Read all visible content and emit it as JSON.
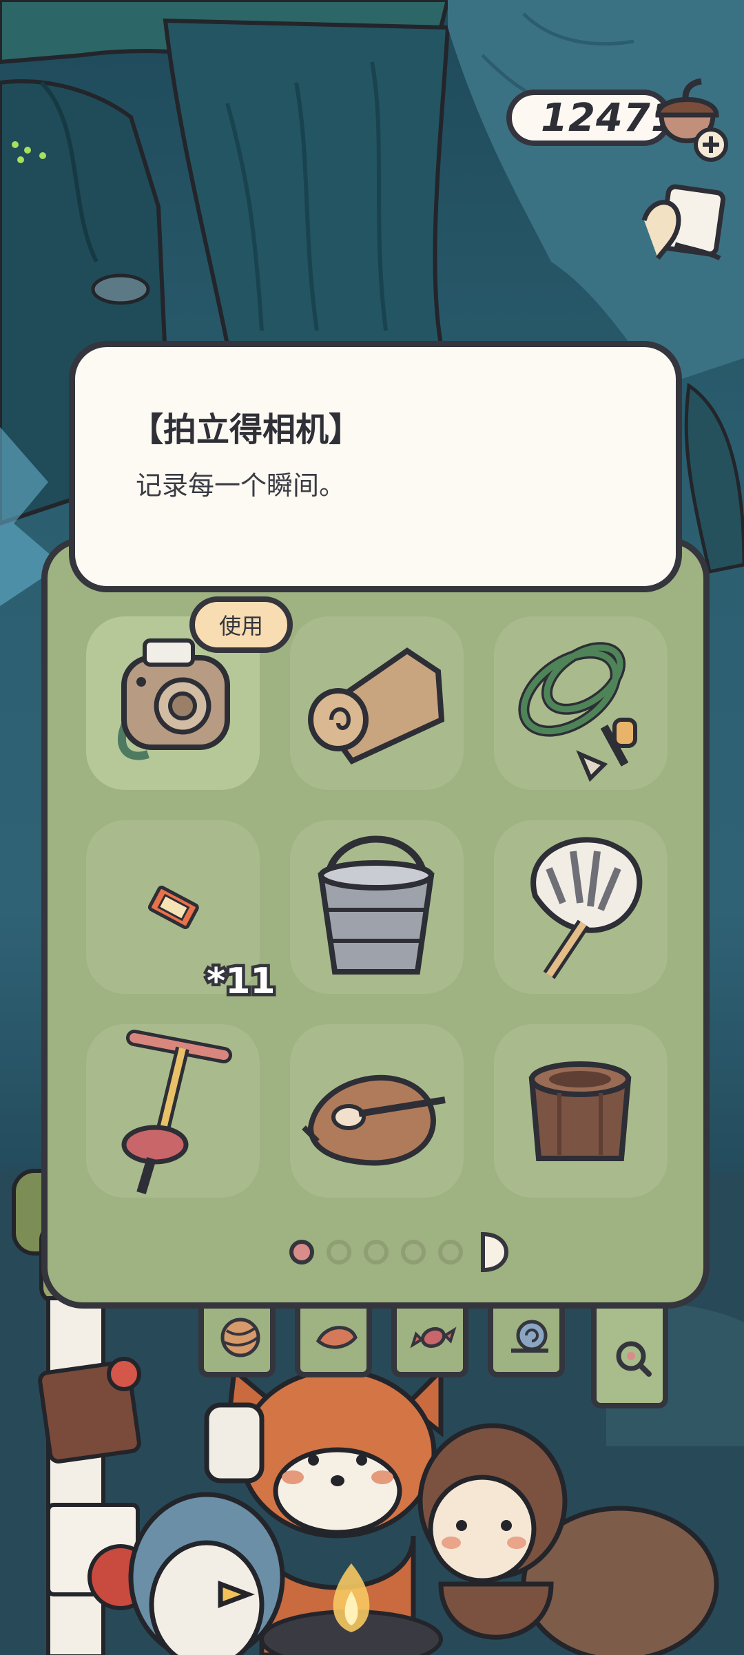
{
  "currency": {
    "value": "12471",
    "icon": "acorn-icon"
  },
  "selected_item": {
    "title": "【拍立得相机】",
    "description": "记录每一个瞬间。"
  },
  "inventory": {
    "use_label": "使用",
    "slots": [
      {
        "icon": "instant-camera-icon",
        "selected": true
      },
      {
        "icon": "rolled-mat-icon"
      },
      {
        "icon": "rope-coil-icon"
      },
      {
        "icon": "ticket-icon",
        "count": "*11"
      },
      {
        "icon": "metal-bucket-icon"
      },
      {
        "icon": "hand-fan-icon"
      },
      {
        "icon": "hand-pump-icon"
      },
      {
        "icon": "roast-chicken-icon"
      },
      {
        "icon": "wooden-bucket-icon"
      }
    ],
    "pages": {
      "total": 5,
      "current": 1
    }
  },
  "tabs": [
    {
      "icon": "yarn-ball-icon"
    },
    {
      "icon": "leaf-icon"
    },
    {
      "icon": "candy-icon"
    },
    {
      "icon": "snail-icon"
    },
    {
      "icon": "magnifier-icon",
      "active": true
    }
  ],
  "colors": {
    "panel": "#9fb281",
    "card": "#fdf9f3",
    "outline": "#34353d",
    "use_button": "#f8ddb2",
    "active_dot": "#d98d8a"
  }
}
